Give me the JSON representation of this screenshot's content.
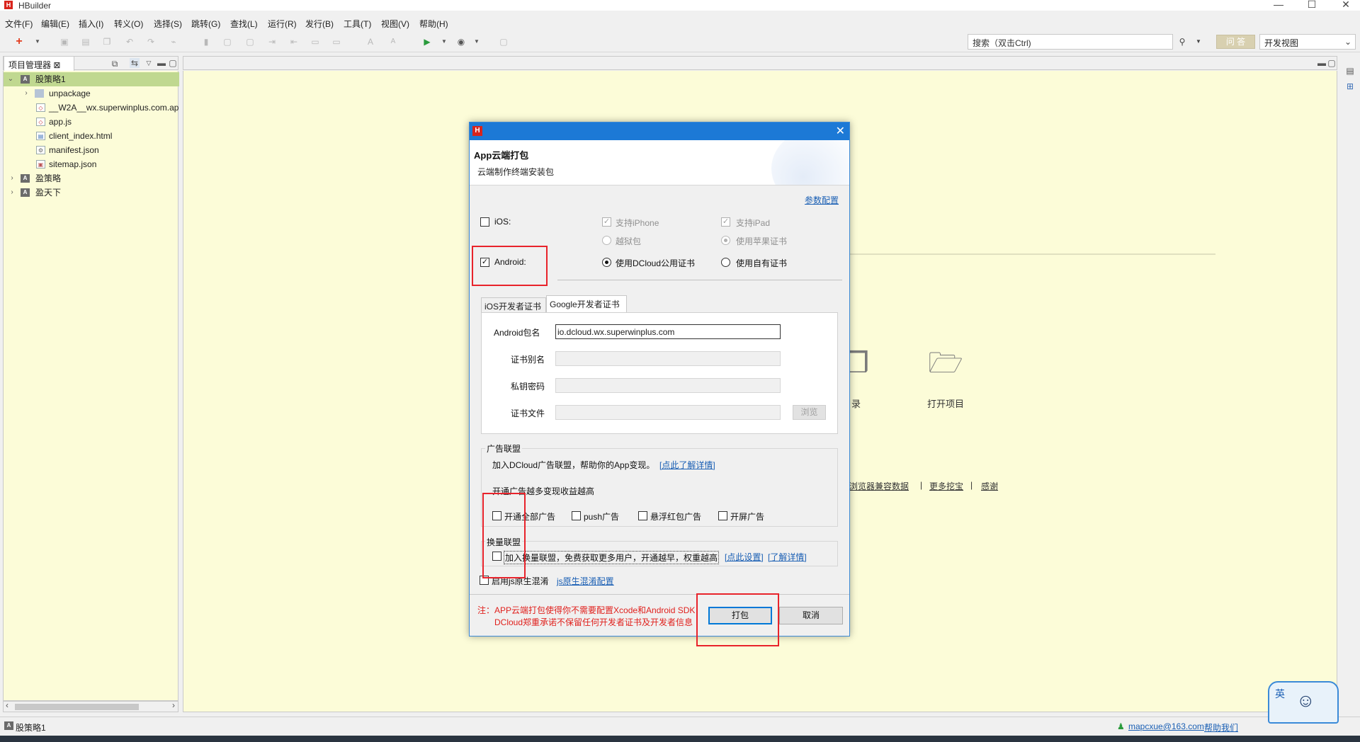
{
  "window": {
    "title": "HBuilder",
    "logo": "H"
  },
  "menu": [
    "文件(F)",
    "编辑(E)",
    "插入(I)",
    "转义(O)",
    "选择(S)",
    "跳转(G)",
    "查找(L)",
    "运行(R)",
    "发行(B)",
    "工具(T)",
    "视图(V)",
    "帮助(H)"
  ],
  "toolbar": {
    "search_placeholder": "搜索（双击Ctrl)",
    "qa_label": "问 答",
    "view_select": "开发视图"
  },
  "project_panel": {
    "tab_label": "项目管理器 ⊠",
    "tree": [
      {
        "label": "股策略1",
        "level": 0,
        "expanded": true,
        "icon": "project-icon"
      },
      {
        "label": "unpackage",
        "level": 1,
        "icon": "folder-icon"
      },
      {
        "label": "__W2A__wx.superwinplus.com.ap",
        "level": 1,
        "icon": "html-file-icon"
      },
      {
        "label": "app.js",
        "level": 1,
        "icon": "js-file-icon"
      },
      {
        "label": "client_index.html",
        "level": 1,
        "icon": "html-file-icon"
      },
      {
        "label": "manifest.json",
        "level": 1,
        "icon": "json-file-icon"
      },
      {
        "label": "sitemap.json",
        "level": 1,
        "icon": "json-file-icon"
      },
      {
        "label": "盈策略",
        "level": 0,
        "icon": "project-icon"
      },
      {
        "label": "盈天下",
        "level": 0,
        "icon": "project-icon"
      }
    ]
  },
  "welcome": {
    "item_dir": "目录",
    "item_open_project": "打开项目",
    "links": [
      "浏览器兼容数据",
      "更多挖宝",
      "感谢"
    ],
    "separator": "|"
  },
  "dialog": {
    "logo": "H",
    "title": "App云端打包",
    "subtitle": "云端制作终端安装包",
    "param_config_link": "参数配置",
    "ios_label": "iOS:",
    "ios_checked": false,
    "ios_iphone": "支持iPhone",
    "ios_ipad": "支持iPad",
    "ios_jailbreak": "越狱包",
    "ios_apple_cert": "使用苹果证书",
    "android_label": "Android:",
    "android_checked": true,
    "android_cert_dcloud": "使用DCloud公用证书",
    "android_cert_own": "使用自有证书",
    "tabs": [
      "iOS开发者证书",
      "Google开发者证书"
    ],
    "active_tab": 1,
    "form": {
      "package_label": "Android包名",
      "package_value": "io.dcloud.wx.superwinplus.com",
      "alias_label": "证书别名",
      "password_label": "私钥密码",
      "file_label": "证书文件",
      "browse_label": "浏览"
    },
    "ad_union": {
      "title": "广告联盟",
      "desc": "加入DCloud广告联盟，帮助你的App变现。",
      "learn_more": "[点此了解详情]",
      "tip": "开通广告越多变现收益越高",
      "options": [
        "开通全部广告",
        "push广告",
        "悬浮红包广告",
        "开屏广告"
      ]
    },
    "exchange_union": {
      "title": "换量联盟",
      "desc": "加入换量联盟，免费获取更多用户，开通越早，权重越高",
      "setup_link": "[点此设置]",
      "learn_link": "[了解详情]"
    },
    "obfuscate_label": "启用js原生混淆",
    "obfuscate_link": "js原生混淆配置",
    "note_line1": "注：APP云端打包使得你不需要配置Xcode和Android SDK",
    "note_line2": "DCloud郑重承诺不保留任何开发者证书及开发者信息",
    "pack_button": "打包",
    "cancel_button": "取消"
  },
  "statusbar": {
    "project": "股策略1",
    "user": "mapcxue@163.com",
    "help": "帮助我们"
  },
  "mascot_text": "英"
}
